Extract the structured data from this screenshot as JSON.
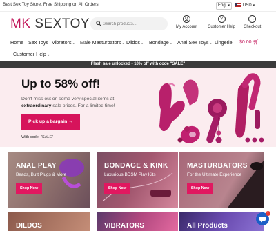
{
  "topbar": {
    "promo": "Best Sex Toy Store, Free Shipping on All Orders!",
    "language": "Engl",
    "currency": "USD"
  },
  "header": {
    "logo_brand": "MK",
    "logo_rest": "SEXTOY",
    "search_placeholder": "Search products...",
    "account_label": "My Account",
    "help_label": "Customer Help",
    "checkout_label": "Checkout"
  },
  "nav": {
    "items": [
      {
        "label": "Home",
        "has_dropdown": false
      },
      {
        "label": "Sex Toys",
        "has_dropdown": false
      },
      {
        "label": "Vibrators",
        "has_dropdown": true
      },
      {
        "label": "Male Masturbators",
        "has_dropdown": true
      },
      {
        "label": "Dildos",
        "has_dropdown": true
      },
      {
        "label": "Bondage",
        "has_dropdown": true
      },
      {
        "label": "Anal Sex Toys",
        "has_dropdown": true
      },
      {
        "label": "Lingerie",
        "has_dropdown": false
      },
      {
        "label": "Customer Help",
        "has_dropdown": true
      }
    ],
    "cart_total": "$0.00"
  },
  "flash_banner": "Flash sale unlocked • 10% off with code \"SALE\"",
  "hero": {
    "headline": "Up to 58% off!",
    "sub_before": "Don't miss out on some very special items at",
    "sub_bold": "extraordinary",
    "sub_after": "sale prices. For a limited time!",
    "cta_label": "Pick up a bargain →",
    "code_note": "With code: \"SALE\""
  },
  "categories": [
    {
      "title": "ANAL PLAY",
      "tagline": "Beads, Butt Plugs & More",
      "button": "Shop Now"
    },
    {
      "title": "BONDAGE & KINK",
      "tagline": "Luxurious BDSM Play Kits",
      "button": "Shop Now"
    },
    {
      "title": "MASTURBATORS",
      "tagline": "For the Ultimate Experience",
      "button": "Shop Now"
    }
  ],
  "categories_row2": [
    {
      "title": "DILDOS"
    },
    {
      "title": "VIBRATORS"
    },
    {
      "title": "All Products"
    }
  ],
  "chat": {
    "badge": "1"
  },
  "colors": {
    "accent": "#d6135b",
    "hero_bg": "#fbecef",
    "flash_bg": "#3b3b3b"
  }
}
